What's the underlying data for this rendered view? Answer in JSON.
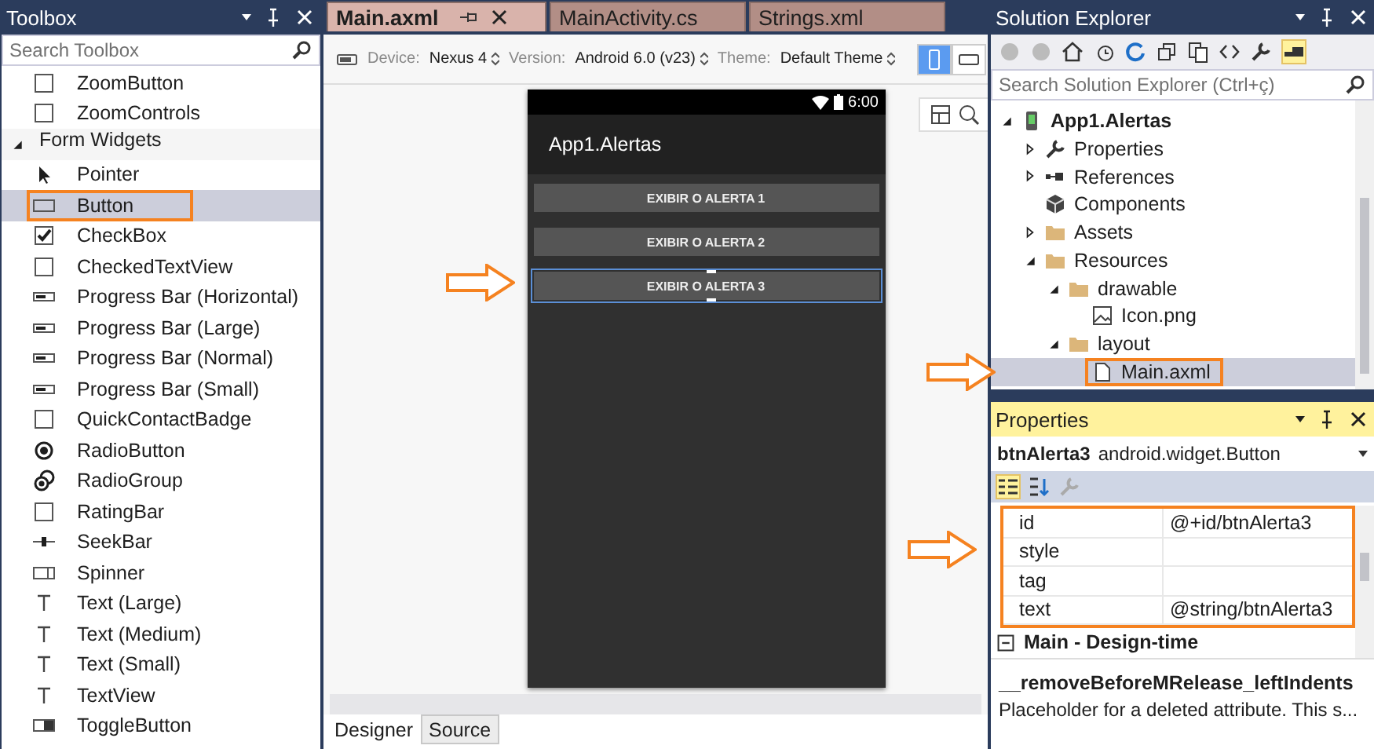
{
  "toolbox": {
    "title": "Toolbox",
    "search_placeholder": "Search Toolbox",
    "items": [
      {
        "kind": "square",
        "label": "ZoomButton",
        "selected": false,
        "highlighted": false
      },
      {
        "kind": "square",
        "label": "ZoomControls",
        "selected": false,
        "highlighted": false
      },
      {
        "kind": "category",
        "label": "Form Widgets",
        "expanded": true,
        "selected": false
      },
      {
        "kind": "pointer",
        "label": "Pointer",
        "selected": false,
        "highlighted": false
      },
      {
        "kind": "button",
        "label": "Button",
        "selected": true,
        "highlighted": true
      },
      {
        "kind": "checkbox",
        "label": "CheckBox",
        "selected": false,
        "highlighted": false
      },
      {
        "kind": "square",
        "label": "CheckedTextView",
        "selected": false,
        "highlighted": false
      },
      {
        "kind": "progress",
        "label": "Progress Bar (Horizontal)",
        "selected": false,
        "highlighted": false
      },
      {
        "kind": "progress",
        "label": "Progress Bar (Large)",
        "selected": false,
        "highlighted": false
      },
      {
        "kind": "progress",
        "label": "Progress Bar (Normal)",
        "selected": false,
        "highlighted": false
      },
      {
        "kind": "progress",
        "label": "Progress Bar (Small)",
        "selected": false,
        "highlighted": false
      },
      {
        "kind": "square",
        "label": "QuickContactBadge",
        "selected": false,
        "highlighted": false
      },
      {
        "kind": "radio",
        "label": "RadioButton",
        "selected": false,
        "highlighted": false
      },
      {
        "kind": "radiogroup",
        "label": "RadioGroup",
        "selected": false,
        "highlighted": false
      },
      {
        "kind": "square",
        "label": "RatingBar",
        "selected": false,
        "highlighted": false
      },
      {
        "kind": "seekbar",
        "label": "SeekBar",
        "selected": false,
        "highlighted": false
      },
      {
        "kind": "spinner",
        "label": "Spinner",
        "selected": false,
        "highlighted": false
      },
      {
        "kind": "text",
        "label": "Text (Large)",
        "selected": false,
        "highlighted": false
      },
      {
        "kind": "text",
        "label": "Text (Medium)",
        "selected": false,
        "highlighted": false
      },
      {
        "kind": "text",
        "label": "Text (Small)",
        "selected": false,
        "highlighted": false
      },
      {
        "kind": "text",
        "label": "TextView",
        "selected": false,
        "highlighted": false
      },
      {
        "kind": "toggle",
        "label": "ToggleButton",
        "selected": false,
        "highlighted": false
      }
    ]
  },
  "editor": {
    "tabs": [
      {
        "label": "Main.axml",
        "selected": true
      },
      {
        "label": "MainActivity.cs",
        "selected": false
      },
      {
        "label": "Strings.xml",
        "selected": false
      }
    ],
    "toolbar": {
      "device": {
        "label": "Device:",
        "value": "Nexus 4"
      },
      "version": {
        "label": "Version:",
        "value": "Android 6.0 (v23)"
      },
      "theme": {
        "label": "Theme:",
        "value": "Default Theme"
      },
      "orientations": [
        {
          "kind": "portrait",
          "selected": true
        },
        {
          "kind": "landscape",
          "selected": false
        }
      ]
    },
    "phone": {
      "status_time": "6:00",
      "app_title": "App1.Alertas",
      "buttons": [
        {
          "label": "EXIBIR O ALERTA 1",
          "selected": false
        },
        {
          "label": "EXIBIR O ALERTA 2",
          "selected": false
        },
        {
          "label": "EXIBIR O ALERTA 3",
          "selected": true
        }
      ]
    },
    "bottom_tabs": [
      {
        "label": "Designer",
        "selected": true
      },
      {
        "label": "Source",
        "selected": false
      }
    ]
  },
  "solution_explorer": {
    "title": "Solution Explorer",
    "search_placeholder": "Search Solution Explorer (Ctrl+ç)",
    "tree": [
      {
        "kind": "project",
        "label": "App1.Alertas",
        "expanded": true,
        "selected": false,
        "highlighted": false,
        "children": [
          {
            "kind": "wrench",
            "label": "Properties",
            "expanded": false,
            "selected": false,
            "highlighted": false
          },
          {
            "kind": "references",
            "label": "References",
            "expanded": false,
            "selected": false,
            "highlighted": false
          },
          {
            "kind": "component",
            "label": "Components",
            "selected": false,
            "highlighted": false
          },
          {
            "kind": "folder",
            "label": "Assets",
            "expanded": false,
            "selected": false,
            "highlighted": false
          },
          {
            "kind": "folder",
            "label": "Resources",
            "expanded": true,
            "selected": false,
            "highlighted": false,
            "children": [
              {
                "kind": "folder",
                "label": "drawable",
                "expanded": true,
                "selected": false,
                "highlighted": false,
                "children": [
                  {
                    "kind": "image",
                    "label": "Icon.png",
                    "selected": false,
                    "highlighted": false
                  }
                ]
              },
              {
                "kind": "folder",
                "label": "layout",
                "expanded": true,
                "selected": false,
                "highlighted": false,
                "children": [
                  {
                    "kind": "file",
                    "label": "Main.axml",
                    "selected": true,
                    "highlighted": true
                  }
                ]
              }
            ]
          }
        ]
      }
    ]
  },
  "properties": {
    "title": "Properties",
    "object_name": "btnAlerta3",
    "object_type": "android.widget.Button",
    "highlighted": true,
    "rows": [
      {
        "name": "id",
        "value": "@+id/btnAlerta3"
      },
      {
        "name": "style"
      },
      {
        "name": "tag"
      },
      {
        "name": "text",
        "value": "@string/btnAlerta3"
      }
    ],
    "category": {
      "label": "Main - Design-time",
      "expanded": true
    },
    "description": {
      "title": "__removeBeforeMRelease_leftIndents",
      "text": "Placeholder for a deleted attribute. This s..."
    }
  }
}
